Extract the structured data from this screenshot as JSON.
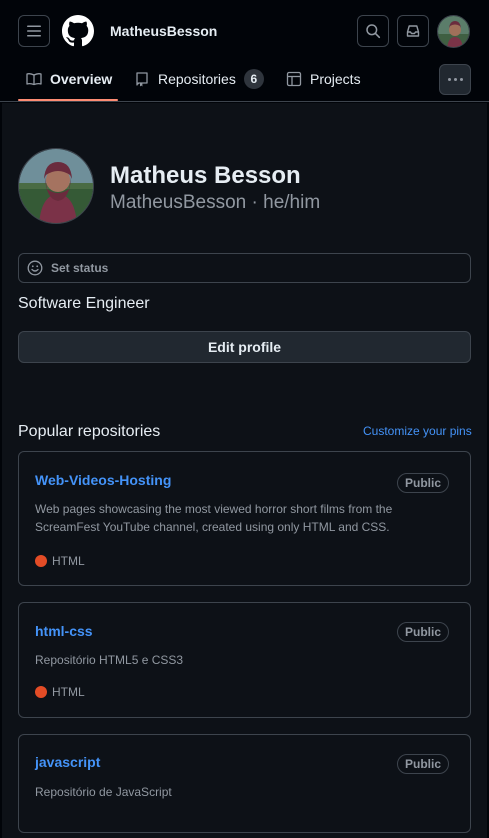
{
  "header": {
    "username": "MatheusBesson"
  },
  "tabs": [
    {
      "label": "Overview",
      "icon": "book-icon"
    },
    {
      "label": "Repositories",
      "icon": "repo-icon",
      "count": "6"
    },
    {
      "label": "Projects",
      "icon": "table-icon"
    }
  ],
  "profile": {
    "full_name": "Matheus Besson",
    "handle": "MatheusBesson · he/him",
    "status_label": "Set status",
    "bio": "Software Engineer",
    "edit_label": "Edit profile"
  },
  "popular": {
    "title": "Popular repositories",
    "customize_label": "Customize your pins"
  },
  "repos": [
    {
      "name": "Web-Videos-Hosting",
      "visibility": "Public",
      "description": "Web pages showcasing the most viewed horror short films from the ScreamFest YouTube channel, created using only HTML and CSS.",
      "language": "HTML",
      "language_color": "#e34c26"
    },
    {
      "name": "html-css",
      "visibility": "Public",
      "description": "Repositório HTML5 e CSS3",
      "language": "HTML",
      "language_color": "#e34c26"
    },
    {
      "name": "javascript",
      "visibility": "Public",
      "description": "Repositório de JavaScript"
    }
  ],
  "colors": {
    "accent": "#4493f8",
    "tab_underline": "#fd8c73",
    "background": "#0d1117"
  }
}
